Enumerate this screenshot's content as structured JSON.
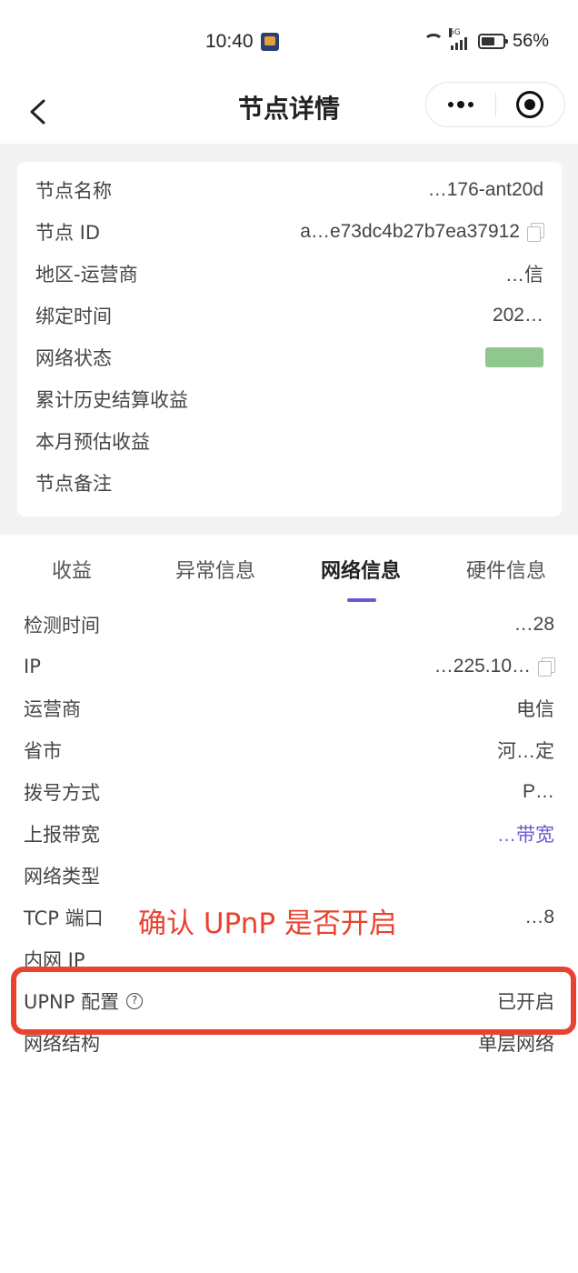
{
  "status_bar": {
    "time": "10:40",
    "signal_label": "5G",
    "battery": "56%",
    "battery_level": 0.56
  },
  "nav": {
    "title": "节点详情",
    "icons": [
      "back-icon",
      "more-icon",
      "target-icon"
    ]
  },
  "card": {
    "rows": [
      {
        "label": "节点名称",
        "value": "…176-ant20d"
      },
      {
        "label": "节点 ID",
        "value": "a…e73dc4b27b7ea37912",
        "copy": true
      },
      {
        "label": "地区-运营商",
        "value": "…信"
      },
      {
        "label": "绑定时间",
        "value": "202…"
      },
      {
        "label": "网络状态",
        "value": ""
      },
      {
        "label": "累计历史结算收益",
        "value": ""
      },
      {
        "label": "本月预估收益",
        "value": ""
      },
      {
        "label": "节点备注",
        "value": ""
      }
    ]
  },
  "tabs": [
    {
      "label": "收益",
      "active": false
    },
    {
      "label": "异常信息",
      "active": false
    },
    {
      "label": "网络信息",
      "active": true
    },
    {
      "label": "硬件信息",
      "active": false
    }
  ],
  "network": {
    "rows": [
      {
        "label": "检测时间",
        "value": "…28"
      },
      {
        "label": "IP",
        "value": "…225.10…",
        "copy": true
      },
      {
        "label": "运营商",
        "value": "电信"
      },
      {
        "label": "省市",
        "value": "河…定"
      },
      {
        "label": "拨号方式",
        "value": "P…"
      },
      {
        "label": "上报带宽",
        "value": "…带宽"
      },
      {
        "label": "网络类型",
        "value": ""
      },
      {
        "label": "TCP 端口",
        "value": "…8"
      },
      {
        "label": "内网 IP",
        "value": ""
      },
      {
        "label": "UPNP 配置",
        "value": "已开启",
        "help": true
      },
      {
        "label": "网络结构",
        "value": "单层网络"
      }
    ]
  },
  "annotation": {
    "text": "确认 UPnP 是否开启",
    "color": "#e8432f"
  },
  "colors": {
    "accent": "#6a5acd",
    "annotation": "#e8432f",
    "background": "#f3f3f3"
  }
}
